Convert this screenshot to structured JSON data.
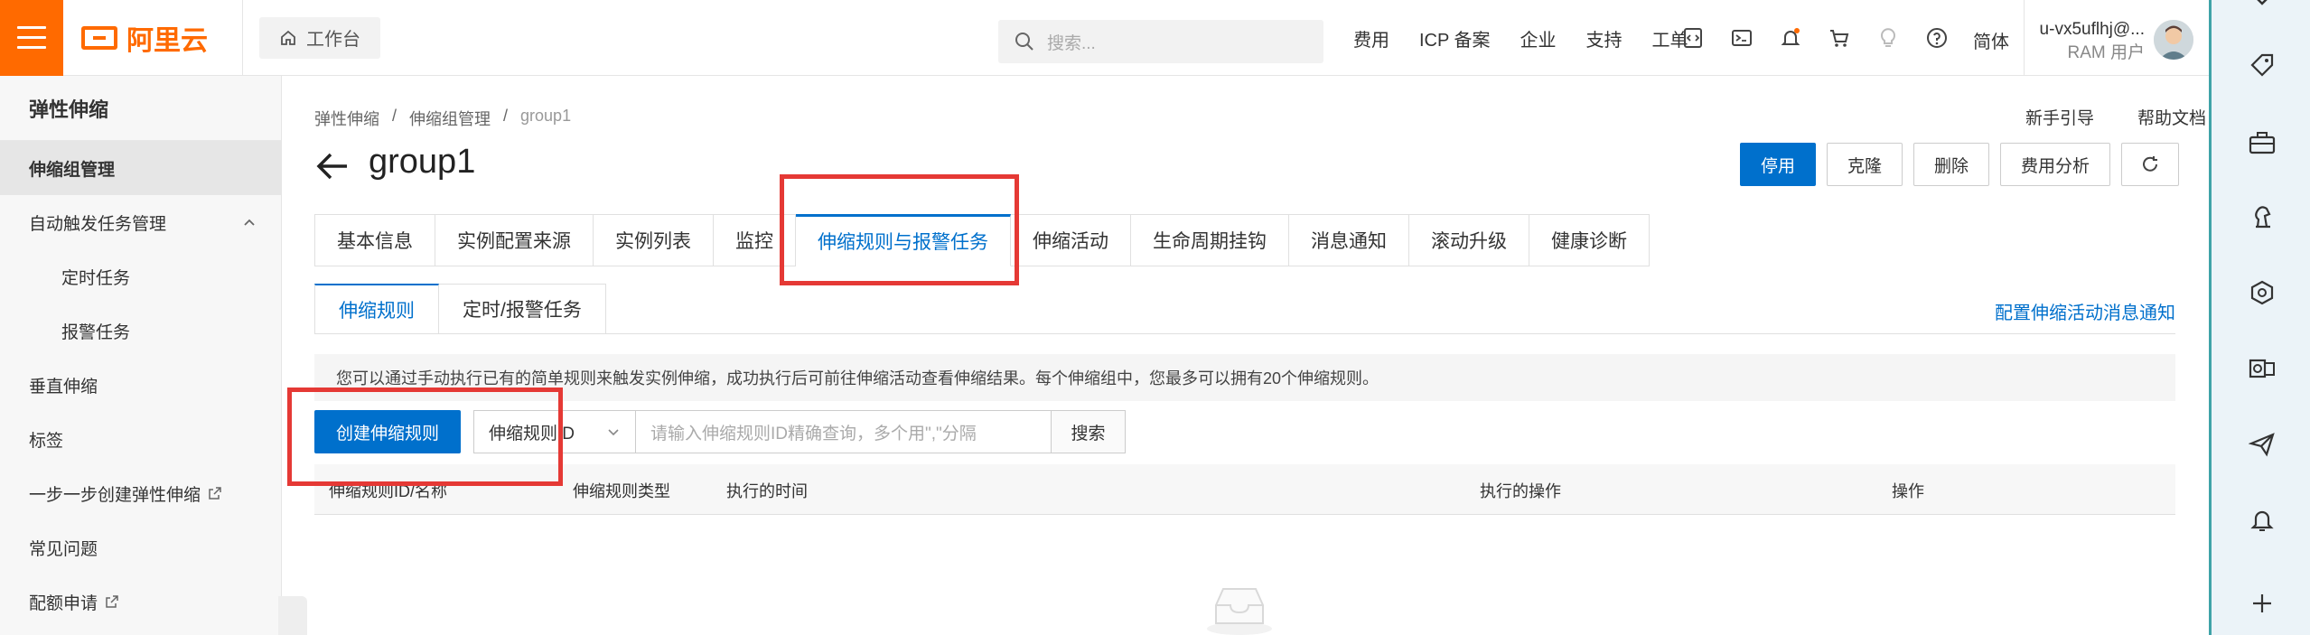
{
  "topbar": {
    "logo_text": "阿里云",
    "workbench_label": "工作台",
    "search_placeholder": "搜索...",
    "nav_items": [
      "费用",
      "ICP 备案",
      "企业",
      "支持",
      "工单"
    ],
    "language": "简体",
    "user_name": "u-vx5uflhj@...",
    "user_role": "RAM 用户",
    "icons": [
      "code-icon",
      "terminal-icon",
      "bell-icon",
      "cart-icon",
      "lightbulb-icon",
      "help-icon"
    ],
    "colors": {
      "brand": "#ff6a00",
      "notification_dot": "#ff6a00"
    }
  },
  "sidebar": {
    "title": "弹性伸缩",
    "items": [
      {
        "label": "伸缩组管理",
        "active": true
      },
      {
        "label": "自动触发任务管理",
        "expanded": true
      },
      {
        "label": "定时任务",
        "sub": true
      },
      {
        "label": "报警任务",
        "sub": true
      },
      {
        "label": "垂直伸缩"
      },
      {
        "label": "标签"
      },
      {
        "label": "一步一步创建弹性伸缩",
        "external": true
      },
      {
        "label": "常见问题"
      },
      {
        "label": "配额申请",
        "external": true
      }
    ]
  },
  "main": {
    "breadcrumb": [
      "弹性伸缩",
      "伸缩组管理",
      "group1"
    ],
    "breadcrumb_sep": "/",
    "help_links": [
      "新手引导",
      "帮助文档"
    ],
    "page_title": "group1",
    "actions": [
      "停用",
      "克隆",
      "删除",
      "费用分析"
    ],
    "tabs": [
      "基本信息",
      "实例配置来源",
      "实例列表",
      "监控",
      "伸缩规则与报警任务",
      "伸缩活动",
      "生命周期挂钩",
      "消息通知",
      "滚动升级",
      "健康诊断"
    ],
    "active_tab": "伸缩规则与报警任务",
    "subtabs": [
      "伸缩规则",
      "定时/报警任务"
    ],
    "active_subtab": "伸缩规则",
    "config_link": "配置伸缩活动消息通知",
    "notice": "您可以通过手动执行已有的简单规则来触发实例伸缩，成功执行后可前往伸缩活动查看伸缩结果。每个伸缩组中，您最多可以拥有20个伸缩规则。",
    "create_button": "创建伸缩规则",
    "filter_select": "伸缩规则ID",
    "search_placeholder": "请输入伸缩规则ID精确查询，多个用\",\"分隔",
    "search_button": "搜索",
    "table_headers": [
      "伸缩规则ID/名称",
      "伸缩规则类型",
      "执行的时间",
      "执行的操作",
      "操作"
    ],
    "colors": {
      "primary": "#0070cc",
      "highlight_box": "#e53935"
    }
  },
  "rightbar": {
    "icons": [
      "tag-icon",
      "toolbox-icon",
      "chess-icon",
      "cube-icon",
      "outlook-icon",
      "send-icon",
      "cloud-bell-icon",
      "plus-icon"
    ]
  }
}
